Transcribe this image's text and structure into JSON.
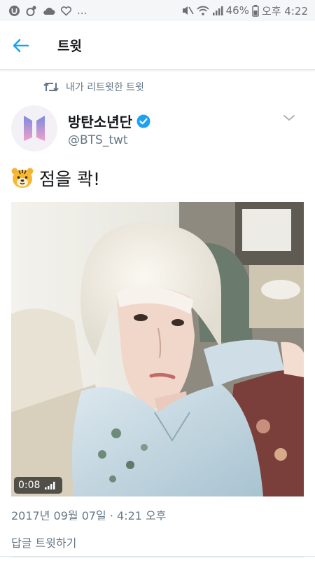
{
  "status_bar": {
    "left_icons": [
      "u-app-icon",
      "notification-dot-icon",
      "cloud-icon",
      "heart-outline-icon"
    ],
    "overflow": "...",
    "battery_percent": "46%",
    "time": "오후 4:22"
  },
  "header": {
    "title": "트윗"
  },
  "tweet": {
    "retweet_context": "내가 리트윗한 트윗",
    "author_name": "방탄소년단",
    "author_handle": "@BTS_twt",
    "verified": true,
    "text": "점을 콱!",
    "emoji_icon": "tiger-face-icon",
    "video": {
      "duration": "0:08"
    },
    "timestamp": "2017년 09월 07일 · 4:21 오후",
    "reply_placeholder": "답글 트윗하기"
  },
  "colors": {
    "accent": "#1da1f2",
    "text_primary": "#14171a",
    "text_secondary": "#657786"
  }
}
